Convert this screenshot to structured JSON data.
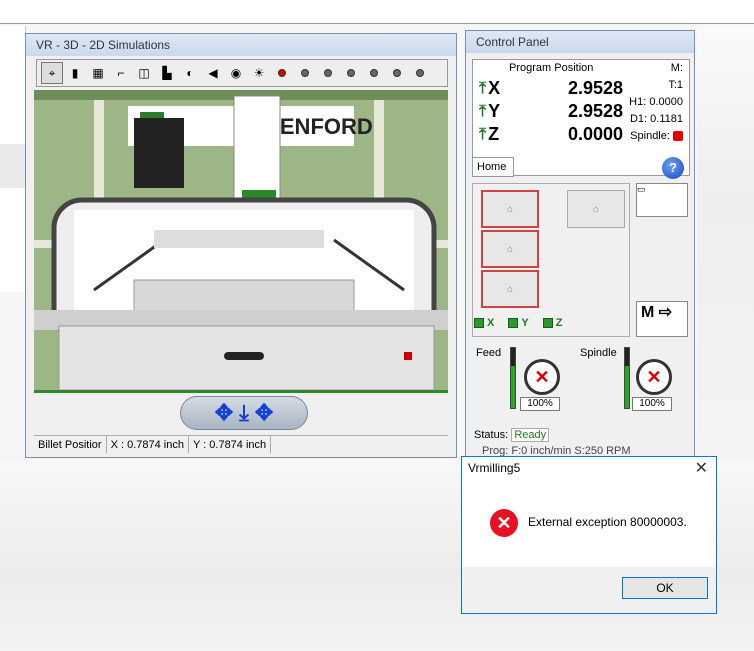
{
  "vr_window": {
    "title": "VR - 3D - 2D Simulations",
    "toolbar_icons": [
      "cursor-icon",
      "bar-icon",
      "chart-icon",
      "path-icon",
      "box-icon",
      "machine-icon",
      "ball-icon",
      "sound-icon",
      "camera-icon",
      "light-icon",
      "record-icon",
      "stop-icon",
      "stop-icon",
      "stop-icon",
      "stop-icon",
      "stop-icon",
      "stop-icon"
    ],
    "logo_text": "DENFORD",
    "status": {
      "billet_label": "Billet Positior",
      "x": "X : 0.7874  inch",
      "y": "Y : 0.7874  inch"
    }
  },
  "control_panel": {
    "title": "Control Panel",
    "program_position_label": "Program Position",
    "axes": [
      {
        "name": "X",
        "value": "2.9528"
      },
      {
        "name": "Y",
        "value": "2.9528"
      },
      {
        "name": "Z",
        "value": "0.0000"
      }
    ],
    "info": {
      "m": "M:",
      "t": "T:1",
      "h1": "H1: 0.0000",
      "d1": "D1: 0.1181",
      "spindle": "Spindle:"
    },
    "home_tab": "Home",
    "help": "?",
    "home_checks": [
      "X",
      "Y",
      "Z"
    ],
    "mcode_label": "M",
    "feed": {
      "label": "Feed",
      "percent": "100%",
      "level": 0.7
    },
    "spindle": {
      "label": "Spindle",
      "percent": "100%",
      "level": 0.7
    },
    "status_label": "Status:",
    "status_value": "Ready",
    "prog_line": "Prog: F:0 inch/min   S:250 RPM"
  },
  "dialog": {
    "title": "Vrmilling5",
    "message": "External exception 80000003.",
    "ok": "OK"
  },
  "colors": {
    "ready": "#1e7a1e",
    "error": "#e81123",
    "accent": "#0078d7"
  }
}
